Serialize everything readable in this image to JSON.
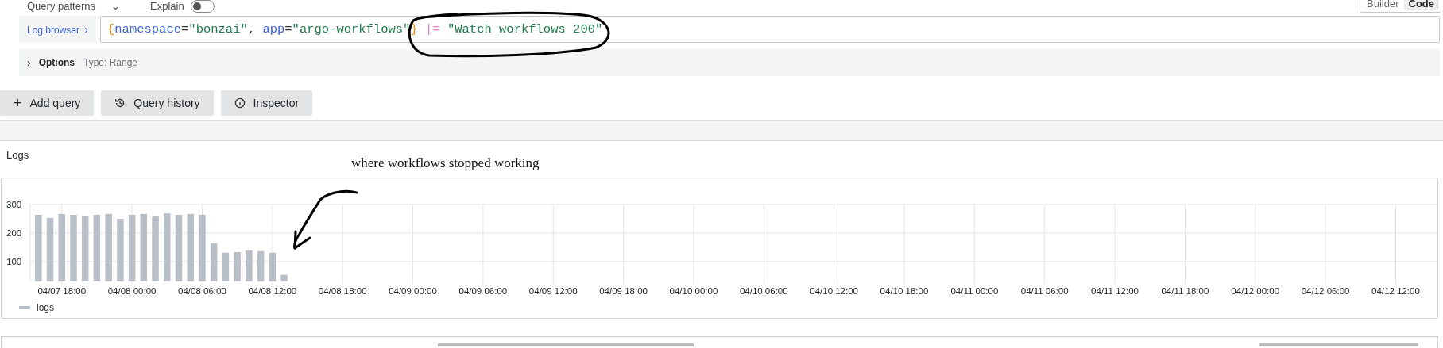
{
  "top_bar": {
    "query_patterns": {
      "label": "Query patterns",
      "caret": "⌄"
    },
    "explain": {
      "label": "Explain",
      "on": false
    },
    "mode_tabs": [
      {
        "label": "Builder",
        "selected": false
      },
      {
        "label": "Code",
        "selected": true
      }
    ]
  },
  "query": {
    "log_browser_button": "Log browser",
    "chevron": "›",
    "tokens": [
      {
        "kind": "brace",
        "text": "{"
      },
      {
        "kind": "label",
        "text": "namespace"
      },
      {
        "kind": "operator",
        "text": "="
      },
      {
        "kind": "string",
        "text": "\"bonzai\""
      },
      {
        "kind": "operator",
        "text": ", "
      },
      {
        "kind": "label",
        "text": "app"
      },
      {
        "kind": "operator",
        "text": "="
      },
      {
        "kind": "string",
        "text": "\"argo-workflows\""
      },
      {
        "kind": "brace",
        "text": "}"
      },
      {
        "kind": "pipe",
        "text": " |= "
      },
      {
        "kind": "string",
        "text": "\"Watch workflows 200\""
      }
    ]
  },
  "options": {
    "chevron": "›",
    "label": "Options",
    "type": "Type: Range",
    "expanded": false
  },
  "buttons": [
    {
      "kind": "add",
      "label": "Add query",
      "icon": "+"
    },
    {
      "kind": "history",
      "label": "Query history"
    },
    {
      "kind": "info",
      "label": "Inspector"
    }
  ],
  "panel": {
    "title": "Logs",
    "chart_data": {
      "type": "bar",
      "categories": [
        null,
        null,
        "04/07 18:00",
        null,
        null,
        null,
        null,
        null,
        "04/08 00:00",
        null,
        null,
        null,
        null,
        null,
        "04/08 06:00",
        null,
        null,
        null,
        null,
        null,
        "04/08 12:00",
        null,
        null,
        null,
        null,
        null,
        "04/08 18:00",
        null,
        null,
        null,
        null,
        null,
        "04/09 00:00",
        null,
        null,
        null,
        null,
        null,
        "04/09 06:00",
        null,
        null,
        null,
        null,
        null,
        "04/09 12:00",
        null,
        null,
        null,
        null,
        null,
        "04/09 18:00",
        null,
        null,
        null,
        null,
        null,
        "04/10 00:00",
        null,
        null,
        null,
        null,
        null,
        "04/10 06:00",
        null,
        null,
        null,
        null,
        null,
        "04/10 12:00",
        null,
        null,
        null,
        null,
        null,
        "04/10 18:00",
        null,
        null,
        null,
        null,
        null,
        "04/11 00:00",
        null,
        null,
        null,
        null,
        null,
        "04/11 06:00",
        null,
        null,
        null,
        null,
        null,
        "04/11 12:00",
        null,
        null,
        null,
        null,
        null,
        "04/11 18:00",
        null,
        null,
        null,
        null,
        null,
        "04/12 00:00",
        null,
        null,
        null,
        null,
        null,
        "04/12 06:00",
        null,
        null,
        null,
        null,
        null,
        "04/12 12:00",
        null,
        null,
        null
      ],
      "series": [
        {
          "name": "logs",
          "color": "#b9bfc9",
          "values": [
            264,
            253,
            267,
            264,
            261,
            264,
            267,
            250,
            264,
            267,
            258,
            269,
            264,
            267,
            264,
            164,
            131,
            133,
            139,
            136,
            131,
            53,
            null,
            null,
            null,
            null,
            null,
            null,
            null,
            null,
            null,
            null,
            null,
            null,
            null,
            null,
            null,
            null,
            null,
            null,
            null,
            null,
            null,
            null,
            null,
            null,
            null,
            null,
            null,
            null,
            null,
            null,
            null,
            null,
            null,
            null,
            null,
            null,
            null,
            null,
            null,
            null,
            null,
            null,
            null,
            null,
            null,
            null,
            null,
            null,
            null,
            null,
            null,
            null,
            null,
            null,
            null,
            null,
            null,
            null,
            null,
            null,
            null,
            null,
            null,
            null,
            null,
            null,
            null,
            null,
            null,
            null,
            null,
            null,
            null,
            null,
            null,
            null,
            null,
            null,
            null,
            null,
            null,
            null,
            null,
            null,
            null,
            null,
            null,
            null,
            null,
            null,
            null,
            null,
            null,
            null,
            null,
            null,
            null,
            null
          ]
        }
      ],
      "grid": true,
      "ylim": [
        30,
        300
      ],
      "yticks": [
        100,
        200,
        300
      ]
    }
  },
  "annotation": {
    "text": "where workflows stopped working"
  }
}
